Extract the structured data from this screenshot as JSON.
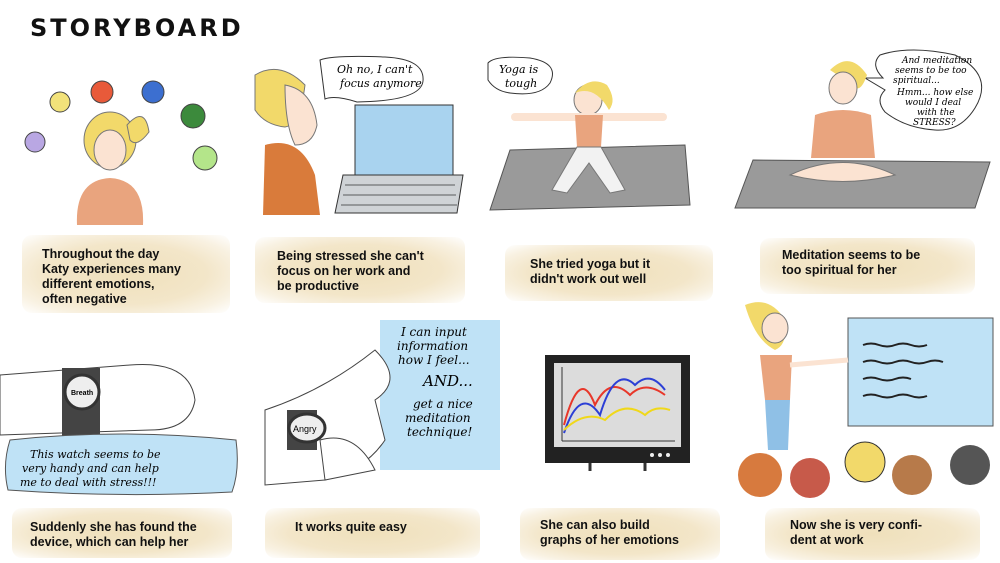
{
  "title": "STORYBOARD",
  "speech": {
    "p2": "Oh no, I can't\nfocus anymore",
    "p3": "Yoga is\ntough",
    "p4_1": "And meditation",
    "p4_2": "seems to be too",
    "p4_3": "spiritual...",
    "p4_4": "Hmm... how else",
    "p4_5": "would I deal",
    "p4_6": "with the",
    "p4_7": "STRESS?",
    "p5": "This watch seems to be\nvery handy and can help\nme to deal with stress!!!",
    "p5_watch": "Breath",
    "p6_watch": "Angry",
    "p6_1": "I can input",
    "p6_2": "information",
    "p6_3": "how I feel...",
    "p6_4": "AND...",
    "p6_5": "get a nice",
    "p6_6": "meditation",
    "p6_7": "technique!"
  },
  "captions": [
    "Throughout the day\nKaty experiences many\ndifferent emotions,\noften negative",
    "Being stressed she can't\nfocus on her work and\nbe productive",
    "She tried yoga but it\ndidn't work out well",
    "Meditation seems to be\ntoo spiritual for her",
    "Suddenly she has found the\ndevice, which can help her",
    "It works quite easy",
    "She can also build\ngraphs of her emotions",
    "Now she is very confi-\ndent at work"
  ],
  "colors": {
    "caption_bg": "#f0e2c0",
    "hair": "#f2d96a",
    "shirt": "#e9a47e",
    "laptop_screen": "#a9d3ef",
    "mat": "#9a9a9a",
    "speech_blue": "#bfe2f6",
    "chart_red": "#e8372a",
    "chart_blue": "#2c3fd6",
    "chart_yellow": "#f0d81a"
  }
}
